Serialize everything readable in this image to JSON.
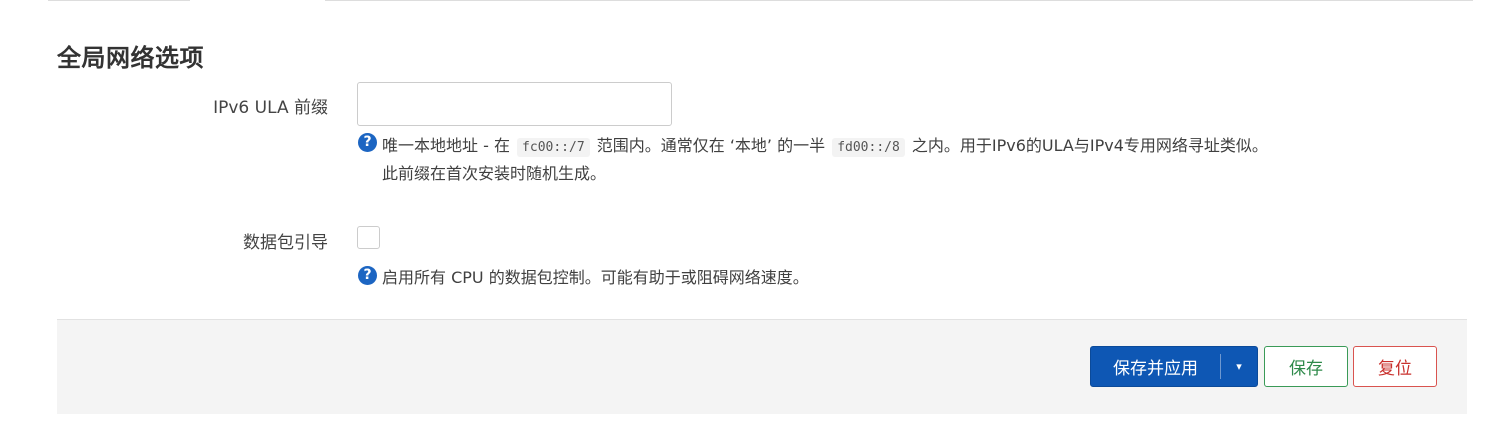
{
  "section": {
    "title": "全局网络选项"
  },
  "ula": {
    "label": "IPv6 ULA 前缀",
    "value": "",
    "help_icon": "question-circle-icon",
    "help_pre": "唯一本地地址 - 在 ",
    "code1": "fc00::/7",
    "help_mid": " 范围内。通常仅在 ‘本地’ 的一半 ",
    "code2": "fd00::/8",
    "help_post": " 之内。用于IPv6的ULA与IPv4专用网络寻址类似。",
    "help_line2": "此前缀在首次安装时随机生成。"
  },
  "packet_steering": {
    "label": "数据包引导",
    "checked": false,
    "help_icon": "question-circle-icon",
    "help": "启用所有 CPU 的数据包控制。可能有助于或阻碍网络速度。"
  },
  "actions": {
    "apply_label": "保存并应用",
    "caret": "▾",
    "save_label": "保存",
    "reset_label": "复位"
  },
  "colors": {
    "primary": "#0e57b4",
    "save": "#2e8a4a",
    "reset": "#c9302c",
    "help_icon": "#1c65c2"
  }
}
